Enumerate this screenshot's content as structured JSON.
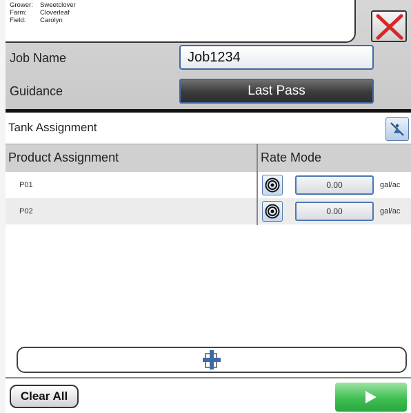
{
  "header": {
    "info": [
      {
        "key": "Grower:",
        "value": "Sweetclover"
      },
      {
        "key": "Farm:",
        "value": "Cloverleaf"
      },
      {
        "key": "Field:",
        "value": "Carolyn"
      }
    ],
    "close_icon": "red-x-icon",
    "job_name_label": "Job Name",
    "job_name_value": "Job1234",
    "guidance_label": "Guidance",
    "guidance_value": "Last Pass"
  },
  "tank": {
    "title": "Tank Assignment",
    "icon": "slashed-nozzle-icon"
  },
  "table": {
    "headers": [
      "Product Assignment",
      "Rate Mode"
    ],
    "rows": [
      {
        "product": "P01",
        "rate": "0.00",
        "unit": "gal/ac",
        "mode_icon": "target-icon"
      },
      {
        "product": "P02",
        "rate": "0.00",
        "unit": "gal/ac",
        "mode_icon": "target-icon"
      }
    ]
  },
  "actions": {
    "add_icon": "plus-icon",
    "clear_all_label": "Clear All",
    "next_icon": "play-arrow-icon"
  },
  "colors": {
    "accent_blue": "#3f6aa4",
    "go_green": "#3fbf52",
    "close_red": "#d62828"
  }
}
